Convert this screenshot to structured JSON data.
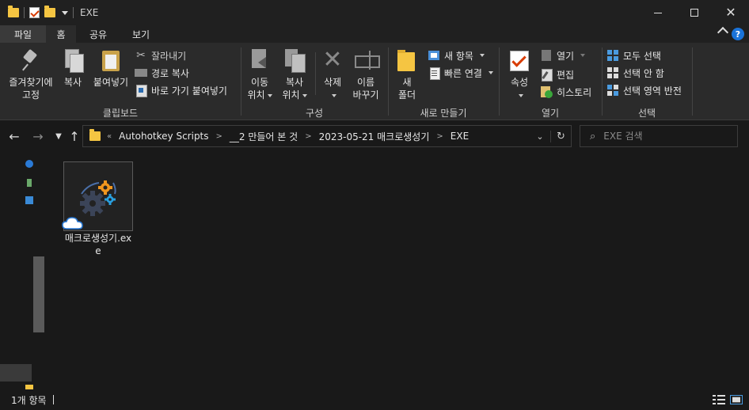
{
  "window": {
    "title": "EXE"
  },
  "ribbon_tabs": [
    {
      "label": "파일"
    },
    {
      "label": "홈"
    },
    {
      "label": "공유"
    },
    {
      "label": "보기"
    }
  ],
  "clipboard": {
    "pin_label_1": "즐겨찾기에",
    "pin_label_2": "고정",
    "copy_label": "복사",
    "paste_label": "붙여넣기",
    "cut_label": "잘라내기",
    "copy_path_label": "경로 복사",
    "paste_shortcut_label": "바로 가기 붙여넣기",
    "group_label": "클립보드"
  },
  "organize": {
    "move_label_1": "이동",
    "move_label_2": "위치",
    "copyto_label_1": "복사",
    "copyto_label_2": "위치",
    "delete_label": "삭제",
    "rename_label_1": "이름",
    "rename_label_2": "바꾸기",
    "group_label": "구성"
  },
  "new": {
    "new_folder_label_1": "새",
    "new_folder_label_2": "폴더",
    "new_item_label": "새 항목",
    "easy_access_label": "빠른 연결",
    "group_label": "새로 만들기"
  },
  "open": {
    "properties_label": "속성",
    "open_label": "열기",
    "edit_label": "편집",
    "history_label": "히스토리",
    "group_label": "열기"
  },
  "select": {
    "select_all_label": "모두 선택",
    "select_none_label": "선택 안 함",
    "invert_label": "선택 영역 반전",
    "group_label": "선택"
  },
  "address": {
    "overflow": "«",
    "crumbs": [
      "Autohotkey Scripts",
      "__2 만들어 본 것",
      "2023-05-21 매크로생성기",
      "EXE"
    ]
  },
  "search": {
    "placeholder": "EXE 검색"
  },
  "files": [
    {
      "name": "매크로생성기.exe"
    }
  ],
  "status": {
    "item_count": "1개 항목"
  },
  "colors": {
    "background": "#191919",
    "ribbon": "#2b2b2b",
    "folder": "#f5c542",
    "accent_blue": "#1a73d9"
  }
}
